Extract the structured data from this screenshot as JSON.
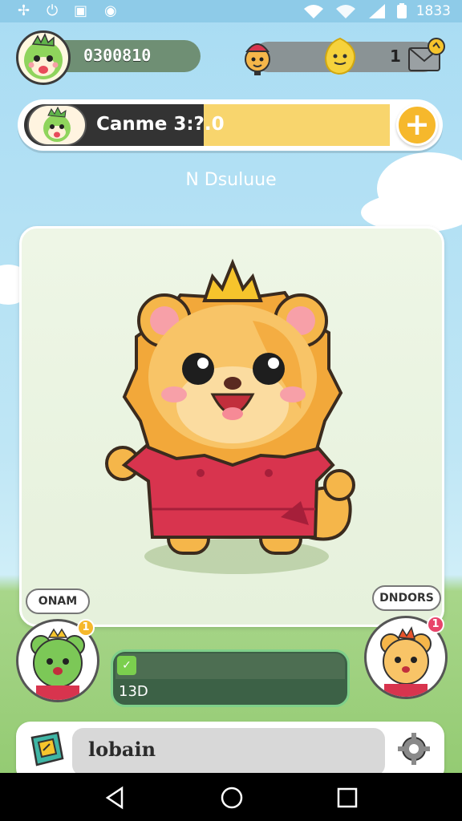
{
  "status_bar": {
    "time": "1833"
  },
  "header": {
    "score": "0300810",
    "counter": "1"
  },
  "banner": {
    "label": "Canme 3:?.0",
    "plus_label": "+"
  },
  "subtitle": "N Dsuluue",
  "card": {
    "left_button": "ONAM",
    "right_button": "DNDORS"
  },
  "badges": {
    "left": "1",
    "right": "1"
  },
  "progress": {
    "label": "13D"
  },
  "bottom": {
    "label": "lobain"
  },
  "colors": {
    "accent": "#f6b82c",
    "progress": "#3c6146",
    "dress": "#d8344e",
    "fur": "#f5b64a"
  },
  "icons": [
    "settings-icon",
    "power-icon",
    "save-icon",
    "wifi-icon",
    "signal-icon",
    "battery-icon",
    "plus-icon",
    "mail-icon",
    "gear-icon",
    "back-icon",
    "home-icon",
    "recents-icon"
  ]
}
